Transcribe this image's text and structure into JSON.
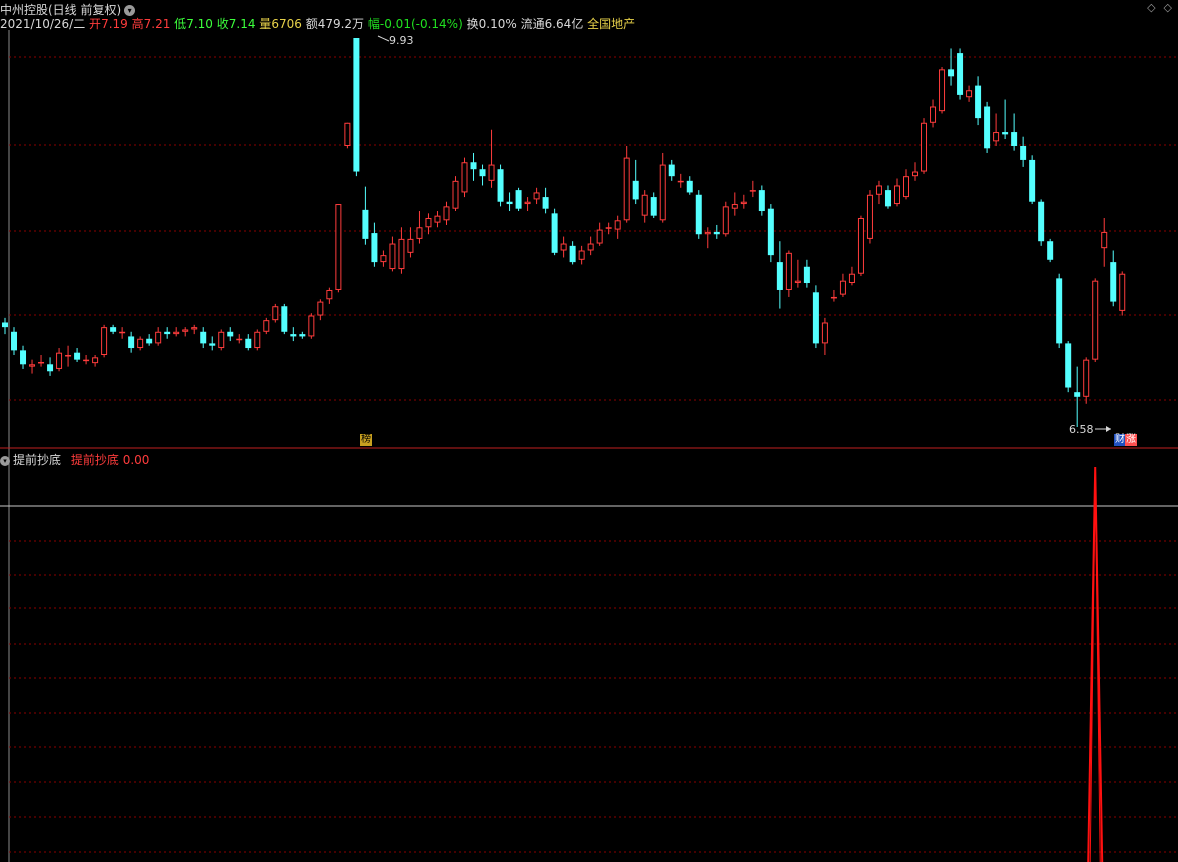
{
  "header": {
    "title": "中州控股(日线 前复权)",
    "date": "2021/10/26/二",
    "open_label": "开",
    "open": "7.19",
    "high_label": "高",
    "high": "7.21",
    "low_label": "低",
    "low": "7.10",
    "close_label": "收",
    "close": "7.14",
    "volume_label": "量",
    "volume": "6706",
    "amount_label": "额",
    "amount": "479.2万",
    "change_label": "幅",
    "change": "-0.01(-0.14%)",
    "turnover_label": "换",
    "turnover": "0.10%",
    "float_label": "流通",
    "float": "6.64亿",
    "sector": "全国地产"
  },
  "controls": {
    "diamond_icon": "◇",
    "close_icon": "◇"
  },
  "main_chart": {
    "high_marker": "9.93",
    "low_marker": "6.58",
    "tag_bang": "榜",
    "tag_cai": "财",
    "tag_zhang": "涨"
  },
  "indicator": {
    "name": "提前抄底",
    "series_label": "提前抄底",
    "value": "0.00"
  },
  "colors": {
    "up": "#ff3c3c",
    "down": "#54ffff",
    "grid": "#8b0000",
    "indicator_line": "#ff1010",
    "bg": "#000000"
  },
  "chart_data": {
    "type": "candlestick",
    "ylim": [
      6.4,
      10.0
    ],
    "candles": [
      {
        "o": 7.48,
        "h": 7.52,
        "l": 7.38,
        "c": 7.44
      },
      {
        "o": 7.4,
        "h": 7.44,
        "l": 7.2,
        "c": 7.24
      },
      {
        "o": 7.24,
        "h": 7.28,
        "l": 7.08,
        "c": 7.12
      },
      {
        "o": 7.1,
        "h": 7.16,
        "l": 7.04,
        "c": 7.12
      },
      {
        "o": 7.14,
        "h": 7.2,
        "l": 7.1,
        "c": 7.14
      },
      {
        "o": 7.12,
        "h": 7.18,
        "l": 7.02,
        "c": 7.06
      },
      {
        "o": 7.08,
        "h": 7.26,
        "l": 7.06,
        "c": 7.22
      },
      {
        "o": 7.2,
        "h": 7.28,
        "l": 7.1,
        "c": 7.2
      },
      {
        "o": 7.22,
        "h": 7.26,
        "l": 7.14,
        "c": 7.16
      },
      {
        "o": 7.16,
        "h": 7.2,
        "l": 7.12,
        "c": 7.16
      },
      {
        "o": 7.13,
        "h": 7.2,
        "l": 7.1,
        "c": 7.18
      },
      {
        "o": 7.2,
        "h": 7.46,
        "l": 7.18,
        "c": 7.44
      },
      {
        "o": 7.44,
        "h": 7.46,
        "l": 7.38,
        "c": 7.4
      },
      {
        "o": 7.4,
        "h": 7.44,
        "l": 7.34,
        "c": 7.4
      },
      {
        "o": 7.36,
        "h": 7.4,
        "l": 7.22,
        "c": 7.26
      },
      {
        "o": 7.26,
        "h": 7.36,
        "l": 7.24,
        "c": 7.34
      },
      {
        "o": 7.34,
        "h": 7.38,
        "l": 7.28,
        "c": 7.3
      },
      {
        "o": 7.3,
        "h": 7.44,
        "l": 7.28,
        "c": 7.4
      },
      {
        "o": 7.4,
        "h": 7.44,
        "l": 7.34,
        "c": 7.38
      },
      {
        "o": 7.38,
        "h": 7.44,
        "l": 7.36,
        "c": 7.4
      },
      {
        "o": 7.4,
        "h": 7.44,
        "l": 7.36,
        "c": 7.42
      },
      {
        "o": 7.42,
        "h": 7.46,
        "l": 7.38,
        "c": 7.44
      },
      {
        "o": 7.4,
        "h": 7.44,
        "l": 7.26,
        "c": 7.3
      },
      {
        "o": 7.3,
        "h": 7.36,
        "l": 7.24,
        "c": 7.28
      },
      {
        "o": 7.26,
        "h": 7.42,
        "l": 7.24,
        "c": 7.4
      },
      {
        "o": 7.4,
        "h": 7.44,
        "l": 7.32,
        "c": 7.36
      },
      {
        "o": 7.34,
        "h": 7.38,
        "l": 7.3,
        "c": 7.34
      },
      {
        "o": 7.34,
        "h": 7.38,
        "l": 7.24,
        "c": 7.26
      },
      {
        "o": 7.26,
        "h": 7.42,
        "l": 7.24,
        "c": 7.4
      },
      {
        "o": 7.4,
        "h": 7.52,
        "l": 7.38,
        "c": 7.5
      },
      {
        "o": 7.5,
        "h": 7.64,
        "l": 7.48,
        "c": 7.62
      },
      {
        "o": 7.62,
        "h": 7.64,
        "l": 7.38,
        "c": 7.4
      },
      {
        "o": 7.38,
        "h": 7.44,
        "l": 7.32,
        "c": 7.36
      },
      {
        "o": 7.38,
        "h": 7.4,
        "l": 7.34,
        "c": 7.36
      },
      {
        "o": 7.36,
        "h": 7.56,
        "l": 7.34,
        "c": 7.54
      },
      {
        "o": 7.54,
        "h": 7.68,
        "l": 7.5,
        "c": 7.66
      },
      {
        "o": 7.68,
        "h": 7.78,
        "l": 7.64,
        "c": 7.76
      },
      {
        "o": 7.76,
        "h": 8.5,
        "l": 7.74,
        "c": 8.5
      },
      {
        "o": 9.0,
        "h": 9.2,
        "l": 8.98,
        "c": 9.2
      },
      {
        "o": 9.93,
        "h": 9.93,
        "l": 8.74,
        "c": 8.78
      },
      {
        "o": 8.45,
        "h": 8.65,
        "l": 8.15,
        "c": 8.2
      },
      {
        "o": 8.25,
        "h": 8.34,
        "l": 7.96,
        "c": 8.0
      },
      {
        "o": 8.0,
        "h": 8.1,
        "l": 7.96,
        "c": 8.06
      },
      {
        "o": 7.94,
        "h": 8.22,
        "l": 7.92,
        "c": 8.16
      },
      {
        "o": 7.94,
        "h": 8.3,
        "l": 7.9,
        "c": 8.2
      },
      {
        "o": 8.08,
        "h": 8.3,
        "l": 8.04,
        "c": 8.2
      },
      {
        "o": 8.2,
        "h": 8.44,
        "l": 8.16,
        "c": 8.3
      },
      {
        "o": 8.3,
        "h": 8.42,
        "l": 8.24,
        "c": 8.38
      },
      {
        "o": 8.34,
        "h": 8.44,
        "l": 8.3,
        "c": 8.4
      },
      {
        "o": 8.36,
        "h": 8.52,
        "l": 8.32,
        "c": 8.48
      },
      {
        "o": 8.46,
        "h": 8.74,
        "l": 8.44,
        "c": 8.7
      },
      {
        "o": 8.6,
        "h": 8.9,
        "l": 8.56,
        "c": 8.86
      },
      {
        "o": 8.86,
        "h": 8.94,
        "l": 8.7,
        "c": 8.8
      },
      {
        "o": 8.8,
        "h": 8.84,
        "l": 8.66,
        "c": 8.74
      },
      {
        "o": 8.7,
        "h": 9.14,
        "l": 8.64,
        "c": 8.84
      },
      {
        "o": 8.8,
        "h": 8.84,
        "l": 8.48,
        "c": 8.52
      },
      {
        "o": 8.52,
        "h": 8.6,
        "l": 8.44,
        "c": 8.5
      },
      {
        "o": 8.62,
        "h": 8.64,
        "l": 8.44,
        "c": 8.46
      },
      {
        "o": 8.5,
        "h": 8.56,
        "l": 8.44,
        "c": 8.52
      },
      {
        "o": 8.54,
        "h": 8.64,
        "l": 8.5,
        "c": 8.6
      },
      {
        "o": 8.56,
        "h": 8.64,
        "l": 8.42,
        "c": 8.46
      },
      {
        "o": 8.42,
        "h": 8.46,
        "l": 8.06,
        "c": 8.08
      },
      {
        "o": 8.1,
        "h": 8.22,
        "l": 8.04,
        "c": 8.16
      },
      {
        "o": 8.14,
        "h": 8.18,
        "l": 7.98,
        "c": 8.0
      },
      {
        "o": 8.02,
        "h": 8.14,
        "l": 7.98,
        "c": 8.1
      },
      {
        "o": 8.1,
        "h": 8.22,
        "l": 8.06,
        "c": 8.16
      },
      {
        "o": 8.16,
        "h": 8.34,
        "l": 8.14,
        "c": 8.28
      },
      {
        "o": 8.3,
        "h": 8.34,
        "l": 8.24,
        "c": 8.3
      },
      {
        "o": 8.28,
        "h": 8.4,
        "l": 8.2,
        "c": 8.36
      },
      {
        "o": 8.36,
        "h": 9.0,
        "l": 8.34,
        "c": 8.9
      },
      {
        "o": 8.7,
        "h": 8.88,
        "l": 8.5,
        "c": 8.54
      },
      {
        "o": 8.4,
        "h": 8.62,
        "l": 8.34,
        "c": 8.58
      },
      {
        "o": 8.56,
        "h": 8.6,
        "l": 8.38,
        "c": 8.4
      },
      {
        "o": 8.36,
        "h": 8.94,
        "l": 8.34,
        "c": 8.84
      },
      {
        "o": 8.84,
        "h": 8.88,
        "l": 8.7,
        "c": 8.74
      },
      {
        "o": 8.7,
        "h": 8.76,
        "l": 8.64,
        "c": 8.7
      },
      {
        "o": 8.7,
        "h": 8.74,
        "l": 8.58,
        "c": 8.6
      },
      {
        "o": 8.58,
        "h": 8.62,
        "l": 8.2,
        "c": 8.24
      },
      {
        "o": 8.24,
        "h": 8.3,
        "l": 8.12,
        "c": 8.26
      },
      {
        "o": 8.26,
        "h": 8.32,
        "l": 8.2,
        "c": 8.24
      },
      {
        "o": 8.24,
        "h": 8.52,
        "l": 8.22,
        "c": 8.48
      },
      {
        "o": 8.46,
        "h": 8.6,
        "l": 8.4,
        "c": 8.5
      },
      {
        "o": 8.5,
        "h": 8.58,
        "l": 8.46,
        "c": 8.52
      },
      {
        "o": 8.62,
        "h": 8.7,
        "l": 8.56,
        "c": 8.62
      },
      {
        "o": 8.62,
        "h": 8.66,
        "l": 8.4,
        "c": 8.44
      },
      {
        "o": 8.46,
        "h": 8.5,
        "l": 8.0,
        "c": 8.06
      },
      {
        "o": 8.0,
        "h": 8.18,
        "l": 7.6,
        "c": 7.76
      },
      {
        "o": 7.76,
        "h": 8.1,
        "l": 7.7,
        "c": 8.08
      },
      {
        "o": 7.82,
        "h": 8.02,
        "l": 7.78,
        "c": 7.84
      },
      {
        "o": 7.96,
        "h": 8.02,
        "l": 7.78,
        "c": 7.82
      },
      {
        "o": 7.74,
        "h": 7.8,
        "l": 7.26,
        "c": 7.3
      },
      {
        "o": 7.3,
        "h": 7.52,
        "l": 7.2,
        "c": 7.48
      },
      {
        "o": 7.7,
        "h": 7.76,
        "l": 7.66,
        "c": 7.7
      },
      {
        "o": 7.72,
        "h": 7.9,
        "l": 7.7,
        "c": 7.84
      },
      {
        "o": 7.82,
        "h": 7.96,
        "l": 7.8,
        "c": 7.9
      },
      {
        "o": 7.9,
        "h": 8.4,
        "l": 7.88,
        "c": 8.38
      },
      {
        "o": 8.2,
        "h": 8.62,
        "l": 8.16,
        "c": 8.58
      },
      {
        "o": 8.58,
        "h": 8.7,
        "l": 8.5,
        "c": 8.66
      },
      {
        "o": 8.62,
        "h": 8.66,
        "l": 8.46,
        "c": 8.48
      },
      {
        "o": 8.5,
        "h": 8.72,
        "l": 8.48,
        "c": 8.66
      },
      {
        "o": 8.56,
        "h": 8.8,
        "l": 8.54,
        "c": 8.74
      },
      {
        "o": 8.74,
        "h": 8.86,
        "l": 8.7,
        "c": 8.78
      },
      {
        "o": 8.78,
        "h": 9.24,
        "l": 8.76,
        "c": 9.2
      },
      {
        "o": 9.2,
        "h": 9.4,
        "l": 9.16,
        "c": 9.34
      },
      {
        "o": 9.3,
        "h": 9.68,
        "l": 9.28,
        "c": 9.66
      },
      {
        "o": 9.66,
        "h": 9.84,
        "l": 9.52,
        "c": 9.6
      },
      {
        "o": 9.8,
        "h": 9.84,
        "l": 9.4,
        "c": 9.44
      },
      {
        "o": 9.42,
        "h": 9.52,
        "l": 9.38,
        "c": 9.48
      },
      {
        "o": 9.52,
        "h": 9.6,
        "l": 9.18,
        "c": 9.24
      },
      {
        "o": 9.34,
        "h": 9.38,
        "l": 8.94,
        "c": 8.98
      },
      {
        "o": 9.04,
        "h": 9.28,
        "l": 9.0,
        "c": 9.12
      },
      {
        "o": 9.12,
        "h": 9.4,
        "l": 9.06,
        "c": 9.1
      },
      {
        "o": 9.12,
        "h": 9.28,
        "l": 8.96,
        "c": 9.0
      },
      {
        "o": 9.0,
        "h": 9.08,
        "l": 8.82,
        "c": 8.88
      },
      {
        "o": 8.88,
        "h": 8.92,
        "l": 8.5,
        "c": 8.52
      },
      {
        "o": 8.52,
        "h": 8.54,
        "l": 8.14,
        "c": 8.18
      },
      {
        "o": 8.18,
        "h": 8.2,
        "l": 8.0,
        "c": 8.02
      },
      {
        "o": 7.86,
        "h": 7.9,
        "l": 7.26,
        "c": 7.3
      },
      {
        "o": 7.3,
        "h": 7.32,
        "l": 6.88,
        "c": 6.92
      },
      {
        "o": 6.88,
        "h": 7.1,
        "l": 6.58,
        "c": 6.84
      },
      {
        "o": 6.84,
        "h": 7.18,
        "l": 6.78,
        "c": 7.16
      },
      {
        "o": 7.16,
        "h": 7.86,
        "l": 7.14,
        "c": 7.84
      },
      {
        "o": 8.12,
        "h": 8.38,
        "l": 7.96,
        "c": 8.26
      },
      {
        "o": 8.0,
        "h": 8.1,
        "l": 7.62,
        "c": 7.66
      },
      {
        "o": 7.58,
        "h": 7.92,
        "l": 7.54,
        "c": 7.9
      }
    ],
    "indicator_series": {
      "name": "提前抄底",
      "spike_index": 121,
      "spike_value": 1.0
    }
  }
}
